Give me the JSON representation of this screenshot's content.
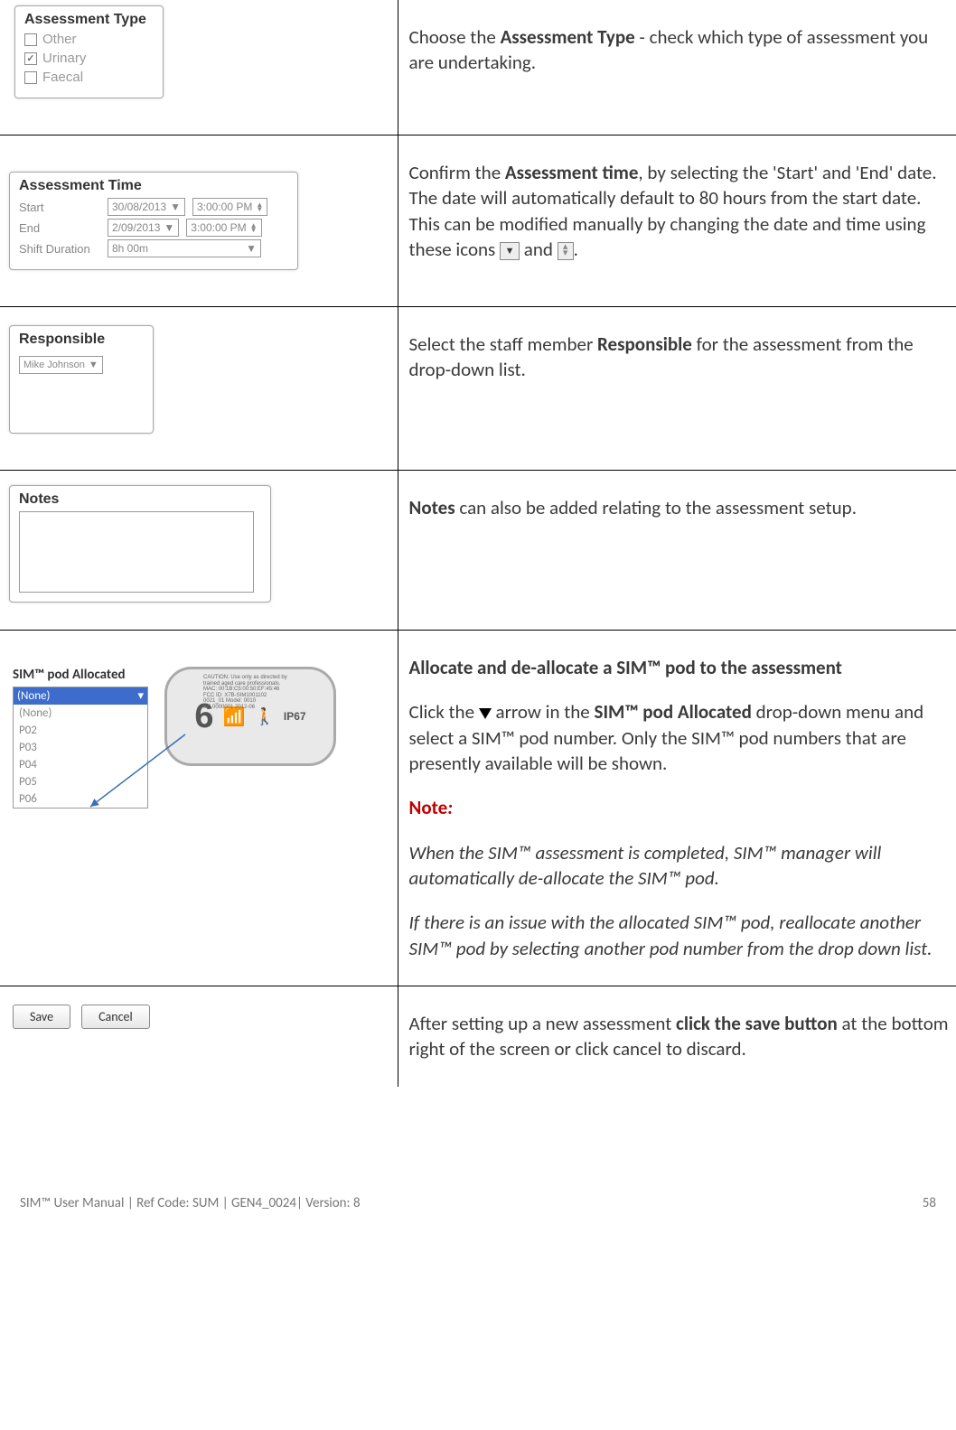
{
  "rows": {
    "assessment_type": {
      "panel_title": "Assessment Type",
      "options": [
        {
          "label": "Other",
          "checked": false
        },
        {
          "label": "Urinary",
          "checked": true
        },
        {
          "label": "Faecal",
          "checked": false
        }
      ],
      "instruction_pre": "Choose the ",
      "instruction_bold": "Assessment Type",
      "instruction_post": " - check which type of assessment you are undertaking."
    },
    "assessment_time": {
      "panel_title": "Assessment Time",
      "rows": [
        {
          "label": "Start",
          "date": "30/08/2013",
          "time": "3:00:00 PM"
        },
        {
          "label": "End",
          "date": "2/09/2013",
          "time": "3:00:00 PM"
        }
      ],
      "shift_label": "Shift Duration",
      "shift_value": "8h 00m",
      "instr_p1_a": "Confirm the ",
      "instr_p1_bold": "Assessment time",
      "instr_p1_b": ", by selecting the 'Start' and 'End' date. The date will automatically default to 80 hours from the start date. This can be modified manually by changing the date and time using these icons ",
      "instr_p1_and": " and ",
      "instr_p1_end": "."
    },
    "responsible": {
      "panel_title": "Responsible",
      "value": "Mike Johnson",
      "instr_a": "Select the staff member ",
      "instr_bold": "Responsible",
      "instr_b": " for the assessment from the drop-down list."
    },
    "notes": {
      "panel_title": "Notes",
      "instr_bold": "Notes",
      "instr_rest": " can also be added relating to the assessment setup."
    },
    "pod": {
      "panel_title": "SIM™ pod Allocated",
      "dropdown_current": "(None)",
      "list": [
        "(None)",
        "P02",
        "P03",
        "P04",
        "P05",
        "P06"
      ],
      "device_number": "6",
      "device_ip": "IP67",
      "device_label": "CAUTION: Use only as directed by trained aged care professionals.\nMAC: 00:1B:C5:00:50:EF:45:46\nFCC ID: X7B-SIM1001102\n0021_01   Model: 0010\nSN 0000001   2012-06",
      "h_bold": "Allocate and de-allocate a SIM™ pod to the assessment",
      "p1_a": "Click the ",
      "p1_b": " arrow in the ",
      "p1_bold": "SIM™ pod Allocated",
      "p1_c": " drop-down menu and select a SIM™ pod number. Only the SIM™ pod numbers that are presently available will be shown.",
      "note_label": "Note",
      "note_colon": ":",
      "ital1": "When the SIM™ assessment is completed, SIM™ manager will automatically de-allocate the SIM™ pod.",
      "ital2": "If there is an issue with the allocated SIM™ pod, reallocate another SIM™ pod by selecting another pod number from the drop down list."
    },
    "save": {
      "save_label": "Save",
      "cancel_label": "Cancel",
      "instr_a": "After setting up a new assessment ",
      "instr_bold": "click the save button",
      "instr_b": " at the bottom right of the screen or click cancel to discard."
    }
  },
  "footer": {
    "left": "SIM™ User Manual | Ref Code: SUM | GEN4_0024| Version: 8",
    "right": "58"
  }
}
